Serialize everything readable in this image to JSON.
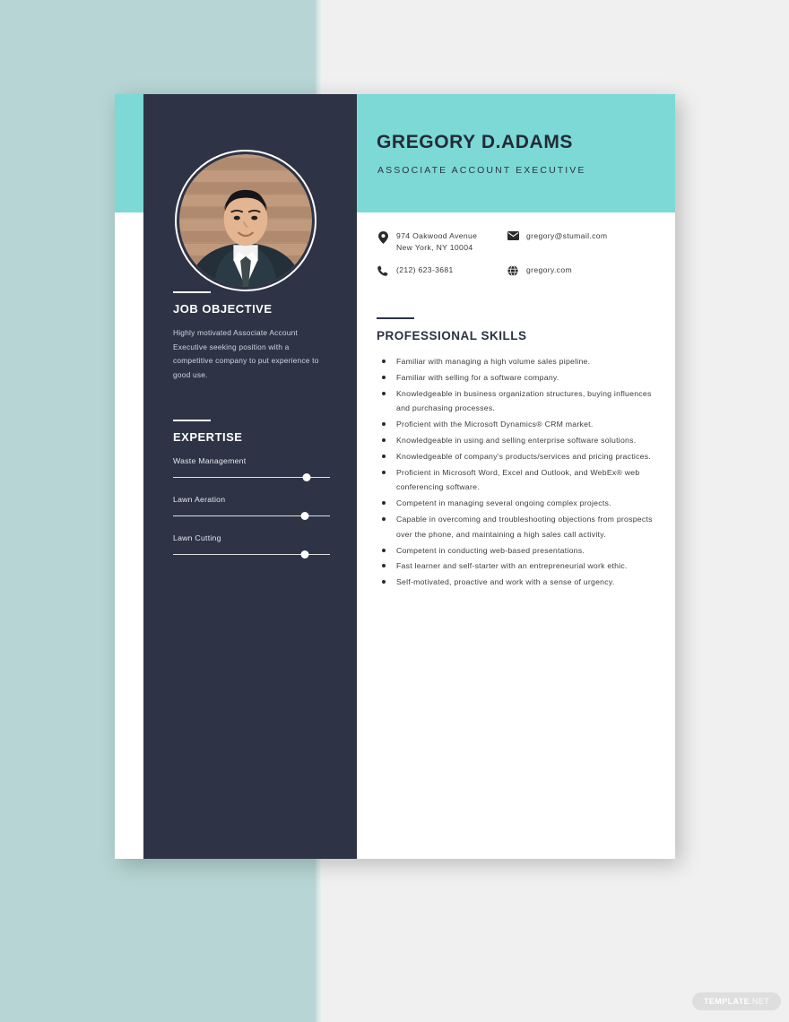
{
  "header": {
    "name": "GREGORY D.ADAMS",
    "role": "ASSOCIATE ACCOUNT EXECUTIVE"
  },
  "contact": {
    "address": "974 Oakwood Avenue\nNew York, NY 10004",
    "email": "gregory@stumail.com",
    "phone": "(212) 623-3681",
    "website": "gregory.com",
    "icons": {
      "address": "map-pin-icon",
      "email": "envelope-icon",
      "phone": "phone-icon",
      "website": "globe-icon"
    }
  },
  "sidebar": {
    "objective": {
      "heading": "JOB OBJECTIVE",
      "text": "Highly motivated Associate Account Executive seeking position with a competitive company to put experience to good use."
    },
    "expertise": {
      "heading": "EXPERTISE",
      "items": [
        {
          "label": "Waste Management",
          "level": 85
        },
        {
          "label": "Lawn Aeration",
          "level": 84
        },
        {
          "label": "Lawn Cutting",
          "level": 84
        }
      ]
    }
  },
  "main": {
    "skills": {
      "heading": "PROFESSIONAL SKILLS",
      "items": [
        "Familiar with managing a high volume sales pipeline.",
        "Familiar with selling for a software company.",
        "Knowledgeable in business organization structures, buying influences and purchasing processes.",
        "Proficient with the Microsoft Dynamics® CRM market.",
        "Knowledgeable in using and selling enterprise software solutions.",
        "Knowledgeable of company's products/services and pricing practices.",
        "Proficient in Microsoft Word, Excel and Outlook, and WebEx® web conferencing software.",
        "Competent in managing several ongoing complex projects.",
        "Capable in overcoming and troubleshooting objections from prospects over the phone, and maintaining a high sales call activity.",
        "Competent in conducting web-based presentations.",
        "Fast learner and self-starter with an entrepreneurial work ethic.",
        "Self-motivated, proactive and work with a sense of urgency."
      ]
    }
  },
  "watermark": {
    "bold": "TEMPLATE",
    "light": ".NET"
  },
  "colors": {
    "teal_accent": "#7cd9d6",
    "teal_panel": "#b6d5d4",
    "sidebar_dark": "#2e3446",
    "canvas": "#f0f0f0"
  }
}
